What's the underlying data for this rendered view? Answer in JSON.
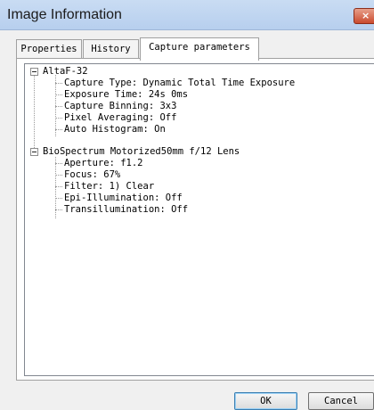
{
  "window": {
    "title": "Image Information",
    "close_glyph": "×"
  },
  "tabs": [
    {
      "label": "Properties",
      "active": false
    },
    {
      "label": "History",
      "active": false
    },
    {
      "label": "Capture parameters",
      "active": true
    }
  ],
  "tree": [
    {
      "label": "AltaF-32",
      "expanded": true,
      "children": [
        "Capture Type: Dynamic Total Time Exposure",
        "Exposure Time: 24s 0ms",
        "Capture Binning: 3x3",
        "Pixel Averaging: Off",
        "Auto Histogram: On"
      ]
    },
    {
      "label": "BioSpectrum Motorized50mm f/12 Lens",
      "expanded": true,
      "children": [
        "Aperture: f1.2",
        "Focus: 67%",
        "Filter: 1) Clear",
        "Epi-Illumination: Off",
        "Transillumination: Off"
      ]
    }
  ],
  "buttons": {
    "ok": "OK",
    "cancel": "Cancel"
  }
}
